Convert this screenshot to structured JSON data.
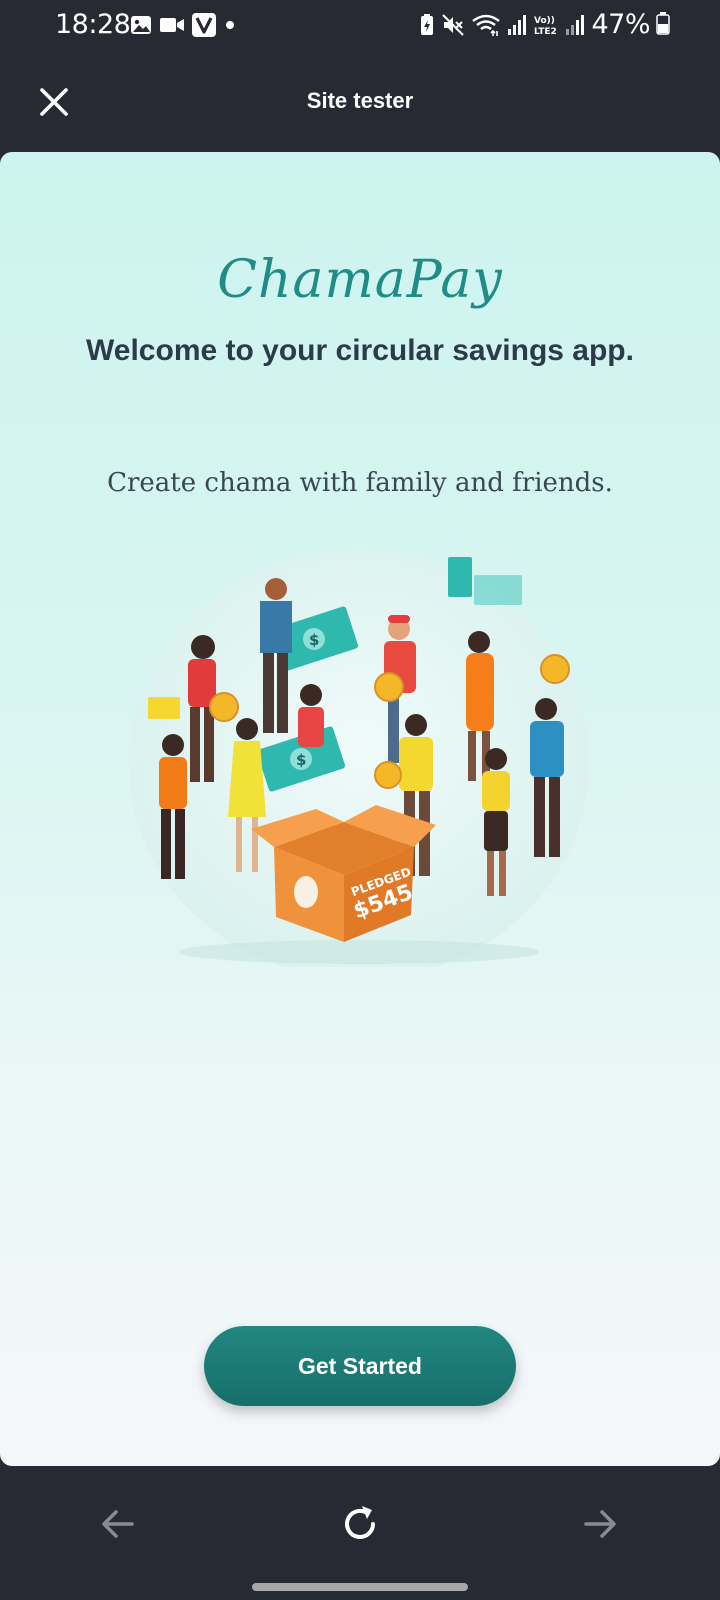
{
  "status_bar": {
    "time": "18:28",
    "battery_percent": "47%",
    "network_label": "Vo)) LTE2"
  },
  "app_bar": {
    "title": "Site tester"
  },
  "page": {
    "brand": "ChamaPay",
    "headline": "Welcome to your circular savings app.",
    "subline": "Create chama with family and friends.",
    "illustration_box_text": "PLEDGED $545",
    "cta_label": "Get Started"
  },
  "icons": {
    "close": "close-icon",
    "back": "arrow-left-icon",
    "reload": "reload-icon",
    "forward": "arrow-right-icon"
  },
  "colors": {
    "brand": "#1f8c86",
    "cta": "#1a7a75",
    "chrome": "#282a33"
  }
}
